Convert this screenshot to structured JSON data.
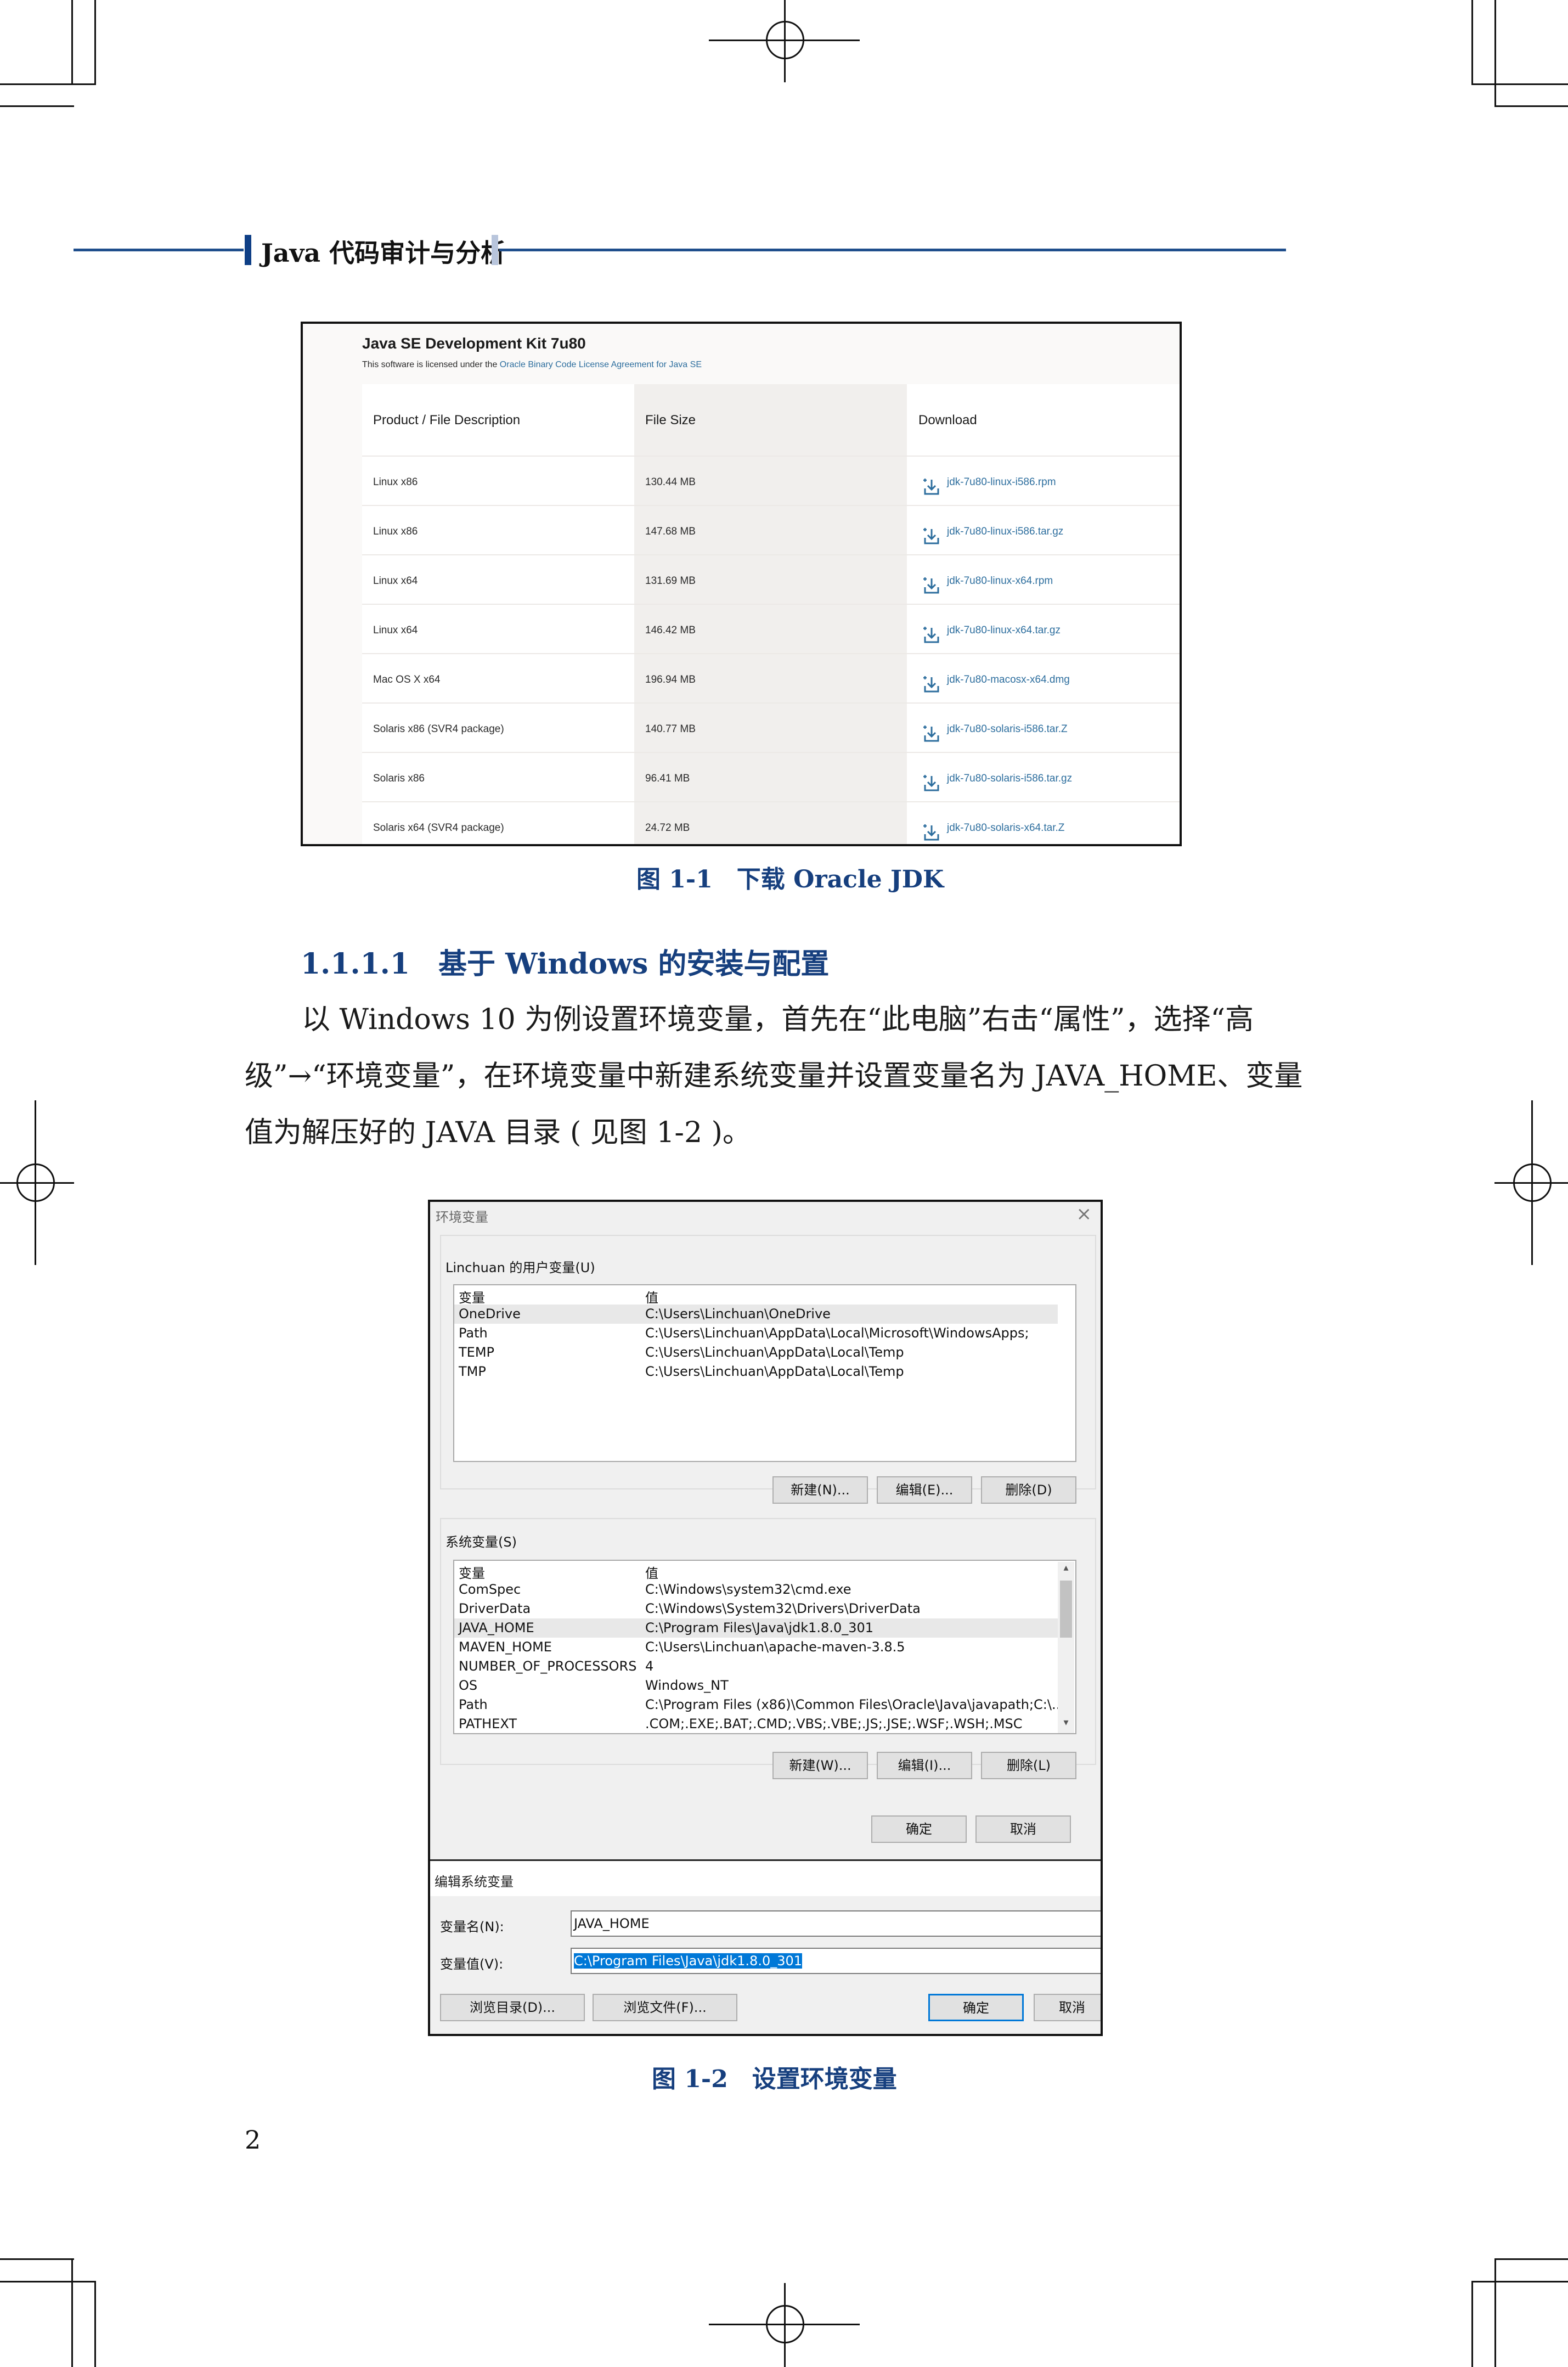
{
  "header": {
    "book_title": "Java 代码审计与分析"
  },
  "figure1": {
    "title": "Java SE Development Kit 7u80",
    "license_prefix": "This software is licensed under the ",
    "license_link": "Oracle Binary Code License Agreement for Java SE",
    "columns": [
      "Product / File Description",
      "File Size",
      "Download"
    ],
    "rows": [
      {
        "product": "Linux x86",
        "size": "130.44 MB",
        "file": "jdk-7u80-linux-i586.rpm"
      },
      {
        "product": "Linux x86",
        "size": "147.68 MB",
        "file": "jdk-7u80-linux-i586.tar.gz"
      },
      {
        "product": "Linux x64",
        "size": "131.69 MB",
        "file": "jdk-7u80-linux-x64.rpm"
      },
      {
        "product": "Linux x64",
        "size": "146.42 MB",
        "file": "jdk-7u80-linux-x64.tar.gz"
      },
      {
        "product": "Mac OS X x64",
        "size": "196.94 MB",
        "file": "jdk-7u80-macosx-x64.dmg"
      },
      {
        "product": "Solaris x86 (SVR4 package)",
        "size": "140.77 MB",
        "file": "jdk-7u80-solaris-i586.tar.Z"
      },
      {
        "product": "Solaris x86",
        "size": "96.41 MB",
        "file": "jdk-7u80-solaris-i586.tar.gz"
      },
      {
        "product": "Solaris x64 (SVR4 package)",
        "size": "24.72 MB",
        "file": "jdk-7u80-solaris-x64.tar.Z"
      }
    ],
    "caption": "图 1-1　下载 Oracle JDK"
  },
  "section": {
    "title": "1.1.1.1　基于 Windows 的安装与配置",
    "paragraph_lines": [
      "以 Windows 10 为例设置环境变量，首先在“此电脑”右击“属性”，选择“高",
      "级”→“环境变量”，在环境变量中新建系统变量并设置变量名为 JAVA_HOME、变量",
      "值为解压好的 JAVA 目录 ( 见图 1-2 )。"
    ]
  },
  "figure2": {
    "window_title": "环境变量",
    "close_glyph": "×",
    "user_group_label": "Linchuan 的用户变量(U)",
    "var_header": "变量",
    "val_header": "值",
    "user_vars": [
      {
        "name": "OneDrive",
        "value": "C:\\Users\\Linchuan\\OneDrive"
      },
      {
        "name": "Path",
        "value": "C:\\Users\\Linchuan\\AppData\\Local\\Microsoft\\WindowsApps;"
      },
      {
        "name": "TEMP",
        "value": "C:\\Users\\Linchuan\\AppData\\Local\\Temp"
      },
      {
        "name": "TMP",
        "value": "C:\\Users\\Linchuan\\AppData\\Local\\Temp"
      }
    ],
    "user_buttons": {
      "new": "新建(N)...",
      "edit": "编辑(E)...",
      "delete": "删除(D)"
    },
    "system_group_label": "系统变量(S)",
    "system_vars": [
      {
        "name": "ComSpec",
        "value": "C:\\Windows\\system32\\cmd.exe"
      },
      {
        "name": "DriverData",
        "value": "C:\\Windows\\System32\\Drivers\\DriverData"
      },
      {
        "name": "JAVA_HOME",
        "value": "C:\\Program Files\\Java\\jdk1.8.0_301"
      },
      {
        "name": "MAVEN_HOME",
        "value": "C:\\Users\\Linchuan\\apache-maven-3.8.5"
      },
      {
        "name": "NUMBER_OF_PROCESSORS",
        "value": "4"
      },
      {
        "name": "OS",
        "value": "Windows_NT"
      },
      {
        "name": "Path",
        "value": "C:\\Program Files (x86)\\Common Files\\Oracle\\Java\\javapath;C:\\..."
      },
      {
        "name": "PATHEXT",
        "value": ".COM;.EXE;.BAT;.CMD;.VBS;.VBE;.JS;.JSE;.WSF;.WSH;.MSC"
      }
    ],
    "system_buttons": {
      "new": "新建(W)...",
      "edit": "编辑(I)...",
      "delete": "删除(L)"
    },
    "ok_label": "确定",
    "cancel_label": "取消",
    "edit_dialog": {
      "title": "编辑系统变量",
      "name_label": "变量名(N):",
      "name_value": "JAVA_HOME",
      "value_label": "变量值(V):",
      "value_value": "C:\\Program Files\\Java\\jdk1.8.0_301",
      "browse_dir": "浏览目录(D)...",
      "browse_file": "浏览文件(F)...",
      "ok": "确定",
      "cancel": "取消"
    },
    "caption": "图 1-2　设置环境变量"
  },
  "page_number": "2"
}
